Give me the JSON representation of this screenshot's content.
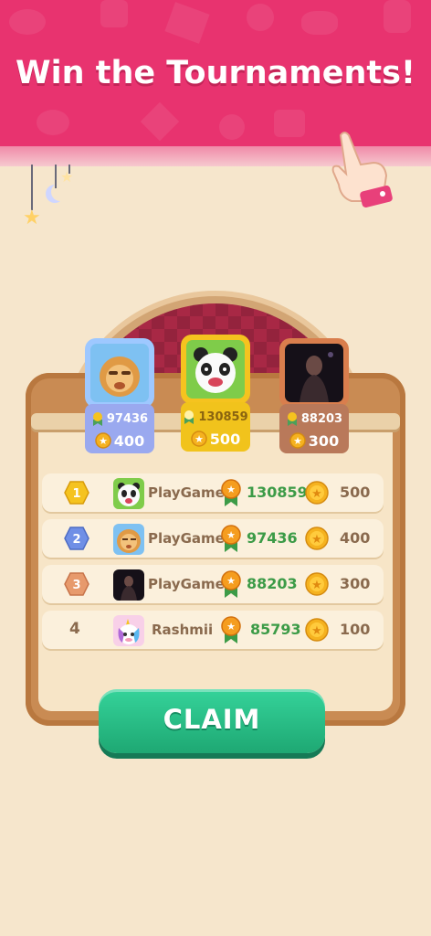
{
  "header": {
    "title": "Win the Tournaments!"
  },
  "podium": [
    {
      "place": "2",
      "score": "97436",
      "reward": "400",
      "frame_color": "#9ec8ff",
      "plate_color": "#9aa9ef",
      "score_color": "#ffffff"
    },
    {
      "place": "1",
      "score": "130859",
      "reward": "500",
      "frame_color": "#f5c31f",
      "plate_color": "#f1c31c",
      "score_color": "#8a6410"
    },
    {
      "place": "3",
      "score": "88203",
      "reward": "300",
      "frame_color": "#d97e4d",
      "plate_color": "#b9795a",
      "score_color": "#ffffff"
    }
  ],
  "leaderboard": [
    {
      "rank": "1",
      "name": "PlayGame",
      "score": "130859",
      "reward": "500",
      "avatar": "panda-icon"
    },
    {
      "rank": "2",
      "name": "PlayGame",
      "score": "97436",
      "reward": "400",
      "avatar": "lion-icon"
    },
    {
      "rank": "3",
      "name": "PlayGame",
      "score": "88203",
      "reward": "300",
      "avatar": "photo-avatar"
    },
    {
      "rank": "4",
      "name": "Rashmii",
      "score": "85793",
      "reward": "100",
      "avatar": "unicorn-icon"
    }
  ],
  "claim_button": {
    "label": "CLAIM"
  },
  "colors": {
    "banner": "#e8336f",
    "background": "#f6e6cc",
    "claim": "#26b981",
    "score_green": "#3c9b47"
  }
}
